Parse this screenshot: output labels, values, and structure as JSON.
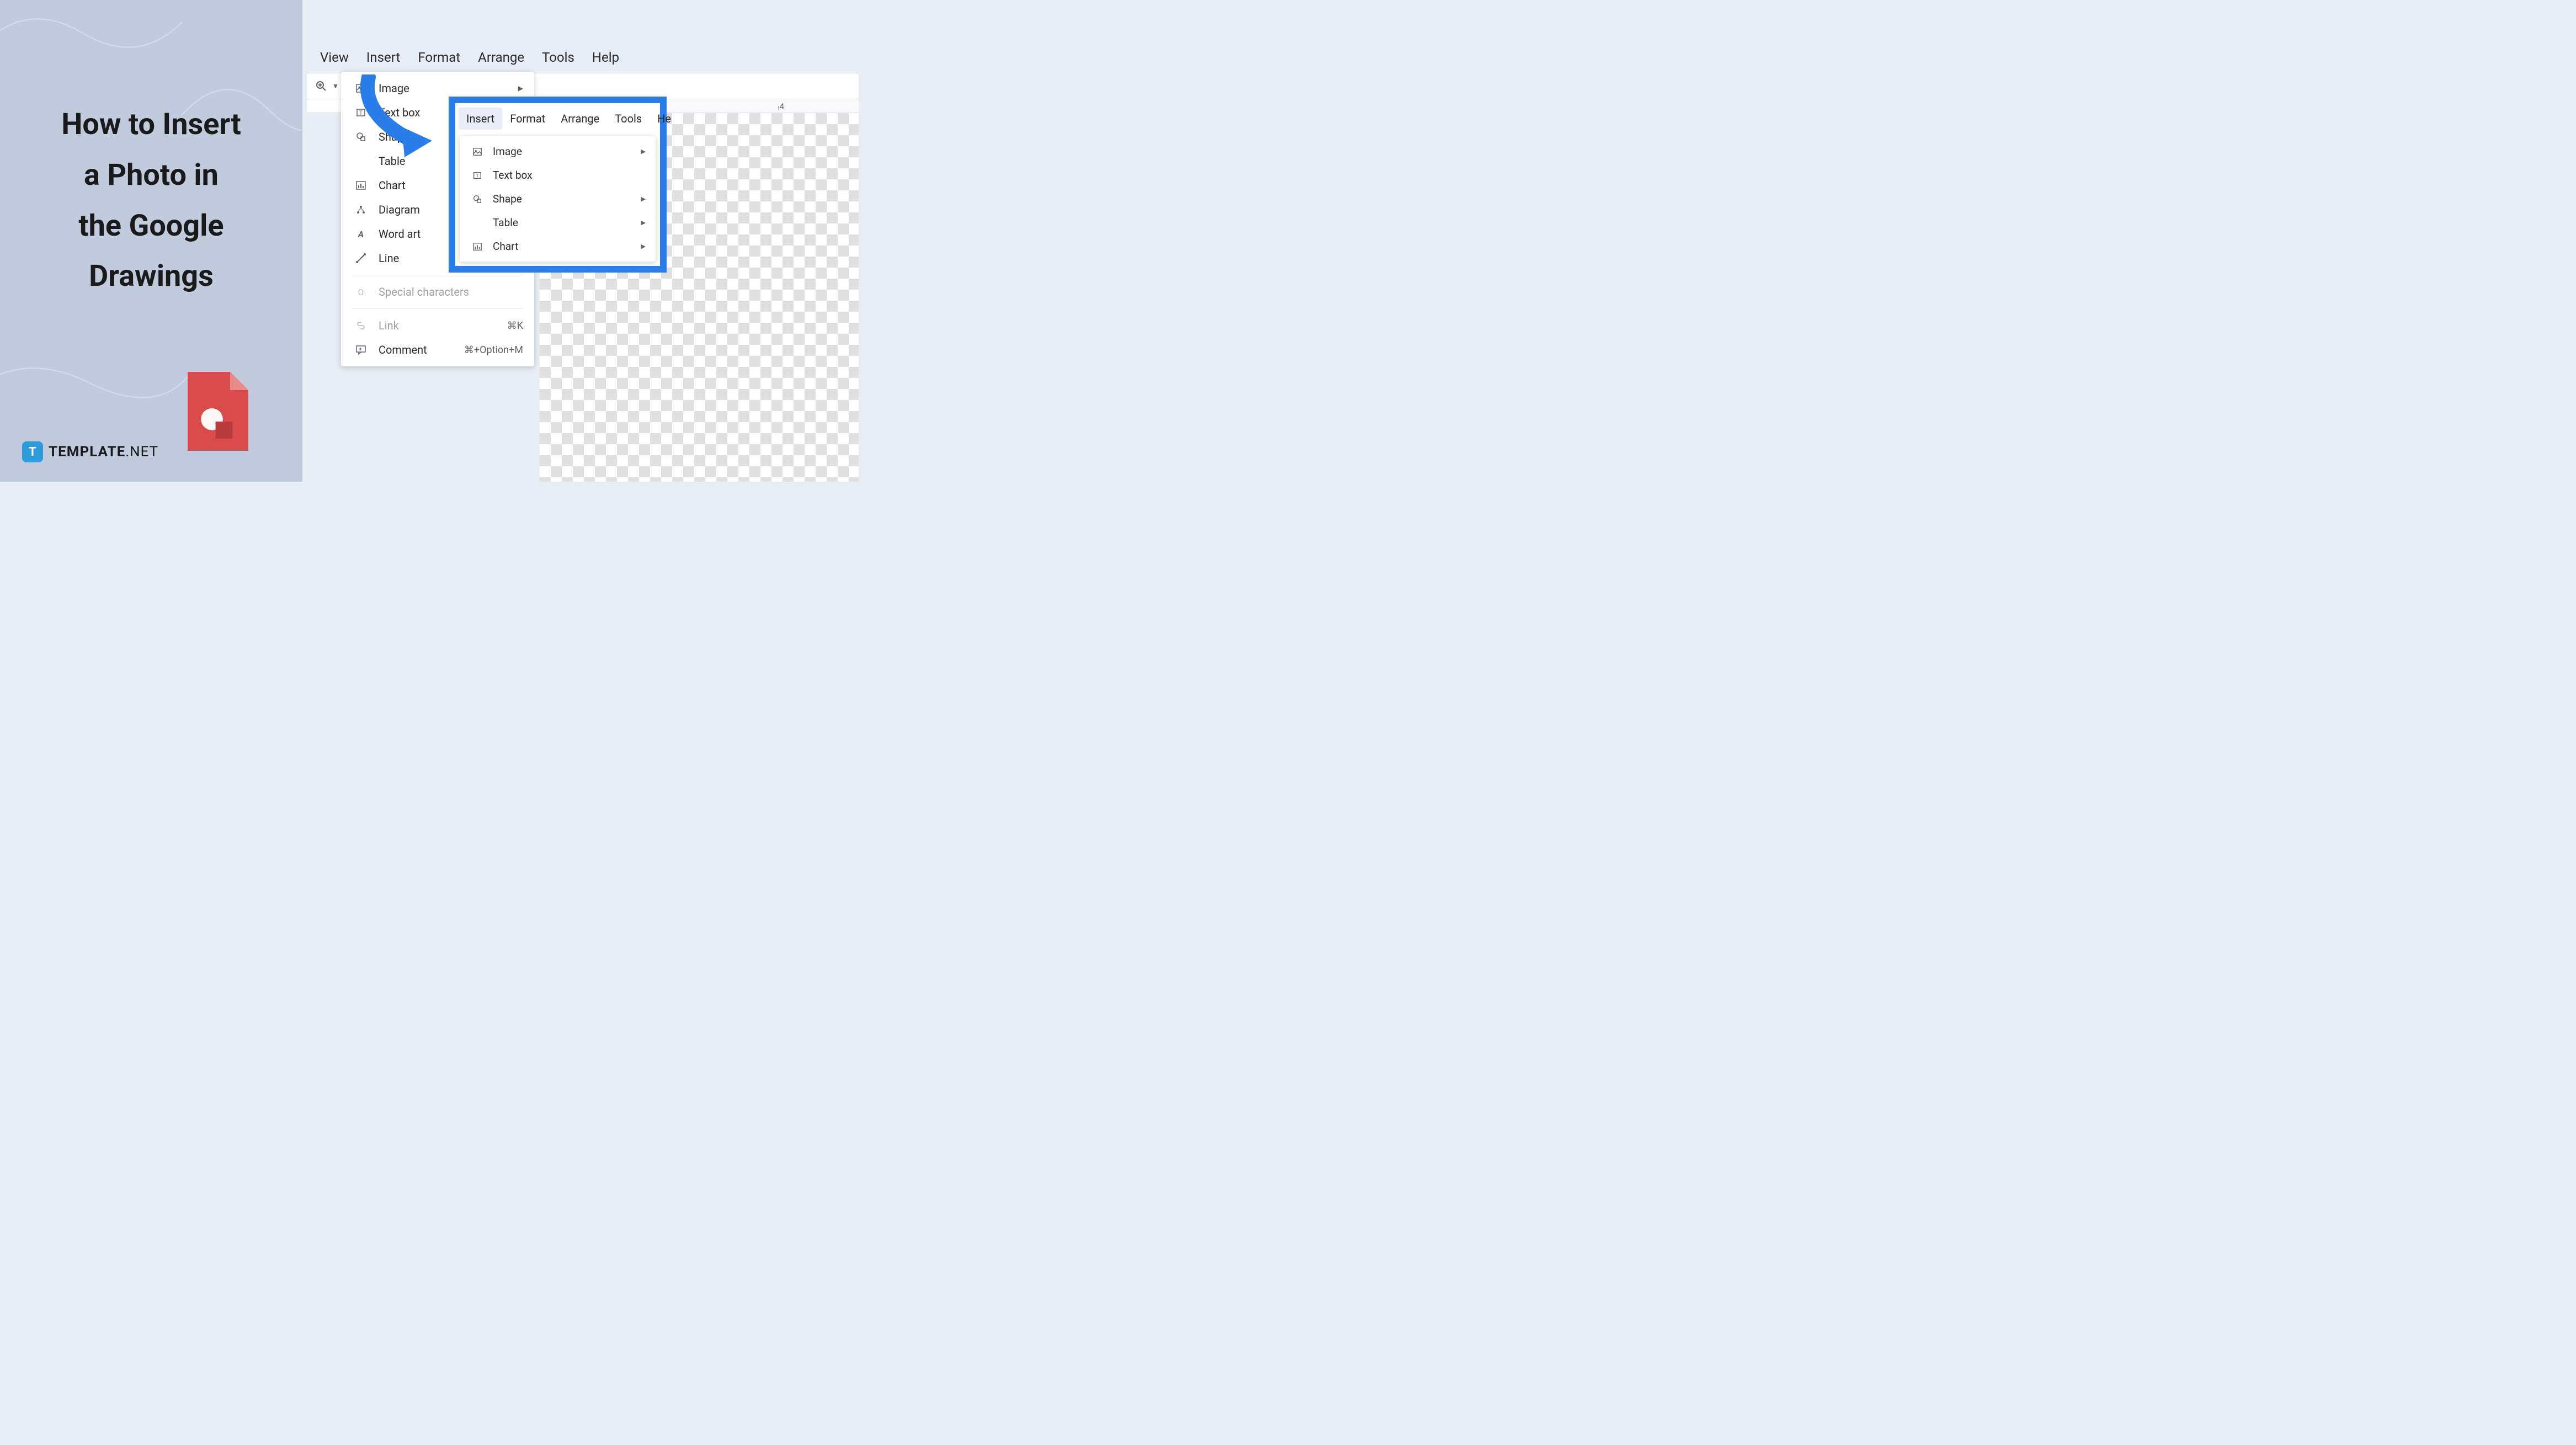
{
  "left": {
    "title_line1": "How to Insert",
    "title_line2": "a Photo in",
    "title_line3": "the Google",
    "title_line4": "Drawings",
    "logo_text": "TEMPLATE",
    "logo_suffix": ".NET",
    "logo_letter": "T"
  },
  "menubar": {
    "items": [
      "View",
      "Insert",
      "Format",
      "Arrange",
      "Tools",
      "Help"
    ],
    "active_index": 1
  },
  "toolbar": {
    "zoom_icon": "zoom"
  },
  "dropdown": {
    "items": [
      {
        "icon": "image",
        "label": "Image",
        "has_arrow": true
      },
      {
        "icon": "textbox",
        "label": "Text box"
      },
      {
        "icon": "shape",
        "label": "Shape",
        "has_arrow": true
      },
      {
        "icon": "",
        "label": "Table",
        "has_arrow": true
      },
      {
        "icon": "chart",
        "label": "Chart",
        "has_arrow": true
      },
      {
        "icon": "diagram",
        "label": "Diagram"
      },
      {
        "icon": "wordart",
        "label": "Word art"
      },
      {
        "icon": "line",
        "label": "Line",
        "has_arrow": true
      }
    ],
    "special": {
      "icon": "omega",
      "label": "Special characters"
    },
    "link": {
      "icon": "link",
      "label": "Link",
      "shortcut": "⌘K"
    },
    "comment": {
      "icon": "comment",
      "label": "Comment",
      "shortcut": "⌘+Option+M"
    }
  },
  "inset": {
    "menubar": [
      "Insert",
      "Format",
      "Arrange",
      "Tools",
      "He"
    ],
    "active_index": 0,
    "items": [
      {
        "icon": "image",
        "label": "Image",
        "has_arrow": true
      },
      {
        "icon": "textbox",
        "label": "Text box"
      },
      {
        "icon": "shape",
        "label": "Shape",
        "has_arrow": true
      },
      {
        "icon": "",
        "label": "Table",
        "has_arrow": true
      },
      {
        "icon": "chart",
        "label": "Chart",
        "has_arrow": true
      }
    ]
  },
  "ruler": {
    "mark": "4"
  }
}
